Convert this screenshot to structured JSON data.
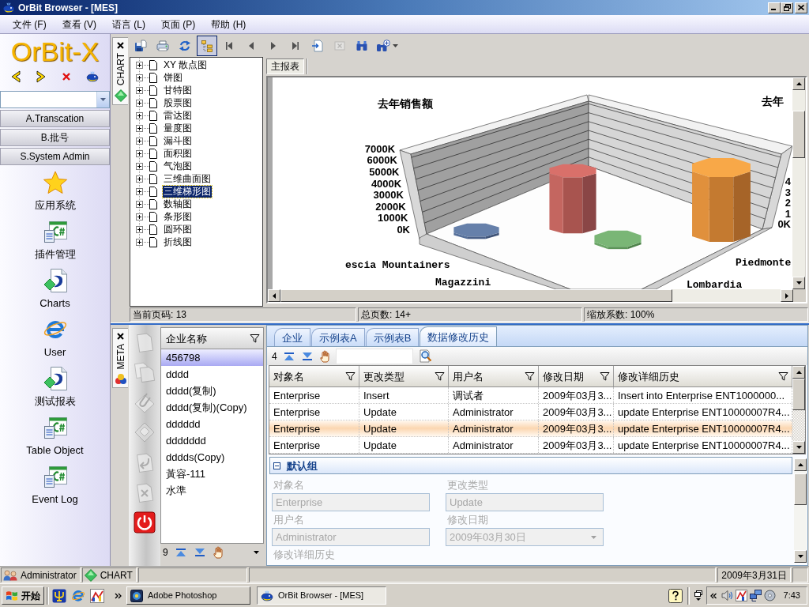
{
  "window": {
    "title": "OrBit Browser - [MES]"
  },
  "menu": [
    "文件 (F)",
    "查看 (V)",
    "语言 (L)",
    "页面 (P)",
    "帮助 (H)"
  ],
  "sidebar": {
    "logo": "OrBit-X",
    "sections": [
      {
        "label": "A.Transcation"
      },
      {
        "label": "B.批号"
      },
      {
        "label": "S.System Admin"
      }
    ],
    "items": [
      {
        "label": "应用系统",
        "kind": "star"
      },
      {
        "label": "插件管理",
        "kind": "csharp"
      },
      {
        "label": "Charts",
        "kind": "report"
      },
      {
        "label": "User",
        "kind": "browser"
      },
      {
        "label": "测试报表",
        "kind": "report"
      },
      {
        "label": "Table Object",
        "kind": "csharp"
      },
      {
        "label": "Event Log",
        "kind": "csharp"
      }
    ]
  },
  "chart_panel": {
    "side_tab": {
      "label": "CHART",
      "kind": "chart"
    },
    "toolbar": [
      {
        "kind": "save",
        "pressed": false,
        "disabled": false
      },
      {
        "kind": "print",
        "pressed": false,
        "disabled": false
      },
      {
        "kind": "refresh",
        "pressed": false,
        "disabled": false
      },
      {
        "kind": "tree",
        "pressed": true,
        "disabled": false
      },
      {
        "kind": "first",
        "pressed": false,
        "disabled": false
      },
      {
        "kind": "prev",
        "pressed": false,
        "disabled": false
      },
      {
        "kind": "next",
        "pressed": false,
        "disabled": false
      },
      {
        "kind": "last",
        "pressed": false,
        "disabled": false
      },
      {
        "kind": "export",
        "pressed": false,
        "disabled": false
      },
      {
        "kind": "close",
        "pressed": false,
        "disabled": true
      },
      {
        "kind": "find",
        "pressed": false,
        "disabled": false
      },
      {
        "kind": "find_more",
        "pressed": false,
        "disabled": false
      }
    ],
    "tree": [
      {
        "label": "XY 散点图",
        "expanded": false,
        "selected": false
      },
      {
        "label": "饼图",
        "expanded": false,
        "selected": false
      },
      {
        "label": "甘特图",
        "expanded": false,
        "selected": false
      },
      {
        "label": "股票图",
        "expanded": false,
        "selected": false
      },
      {
        "label": "雷达图",
        "expanded": false,
        "selected": false
      },
      {
        "label": "量度图",
        "expanded": false,
        "selected": false
      },
      {
        "label": "漏斗图",
        "expanded": false,
        "selected": false
      },
      {
        "label": "面积图",
        "expanded": false,
        "selected": false
      },
      {
        "label": "气泡图",
        "expanded": false,
        "selected": false
      },
      {
        "label": "三维曲面图",
        "expanded": false,
        "selected": false
      },
      {
        "label": "三维梯形图",
        "expanded": false,
        "selected": true
      },
      {
        "label": "数轴图",
        "expanded": false,
        "selected": false
      },
      {
        "label": "条形图",
        "expanded": false,
        "selected": false
      },
      {
        "label": "圆环图",
        "expanded": false,
        "selected": false
      },
      {
        "label": "折线图",
        "expanded": false,
        "selected": false
      }
    ],
    "report_tabs": [
      {
        "label": "主报表",
        "selected": true
      }
    ],
    "chart": {
      "title": "去年销售额",
      "title_right": "去年",
      "y_ticks": [
        "7000K",
        "6000K",
        "5000K",
        "4000K",
        "3000K",
        "2000K",
        "1000K",
        "0K"
      ],
      "right_ticks": [
        "4",
        "3",
        "2",
        "1",
        "0K"
      ],
      "labels": [
        "escia Mountainers",
        "Magazzini",
        "Piedmonte",
        "Lombardia"
      ]
    },
    "status": [
      "当前页码: 13",
      "总页数: 14+",
      "缩放系数: 100%"
    ]
  },
  "meta_panel": {
    "side_tab": {
      "label": "META",
      "kind": "meta"
    },
    "tools": [
      {
        "kind": "new",
        "disabled": true
      },
      {
        "kind": "copy",
        "disabled": true
      },
      {
        "kind": "attach",
        "disabled": true
      },
      {
        "kind": "save",
        "disabled": true
      },
      {
        "kind": "undo",
        "disabled": true
      },
      {
        "kind": "delete",
        "disabled": true
      },
      {
        "kind": "power",
        "disabled": false
      }
    ],
    "list": {
      "header": "企业名称",
      "items": [
        {
          "label": "456798",
          "selected": true
        },
        {
          "label": "dddd",
          "selected": false
        },
        {
          "label": "dddd(复制)",
          "selected": false
        },
        {
          "label": "dddd(复制)(Copy)",
          "selected": false
        },
        {
          "label": "dddddd",
          "selected": false
        },
        {
          "label": "ddddddd",
          "selected": false
        },
        {
          "label": "dddds(Copy)",
          "selected": false
        },
        {
          "label": "黃容-111",
          "selected": false
        },
        {
          "label": "水準",
          "selected": false
        }
      ],
      "count": "9"
    },
    "tabs": [
      {
        "label": "企业",
        "selected": false
      },
      {
        "label": "示例表A",
        "selected": false
      },
      {
        "label": "示例表B",
        "selected": false
      },
      {
        "label": "数据修改历史",
        "selected": true
      }
    ],
    "grid_count": "4",
    "grid": {
      "columns": [
        "对象名",
        "更改类型",
        "用户名",
        "修改日期",
        "修改详细历史"
      ],
      "rows": [
        {
          "cells": [
            "Enterprise",
            "Insert",
            "调试者",
            "2009年03月3...",
            "Insert into Enterprise ENT1000000..."
          ],
          "selected": false
        },
        {
          "cells": [
            "Enterprise",
            "Update",
            "Administrator",
            "2009年03月3...",
            "update Enterprise ENT10000007R4..."
          ],
          "selected": false
        },
        {
          "cells": [
            "Enterprise",
            "Update",
            "Administrator",
            "2009年03月3...",
            "update Enterprise ENT10000007R4..."
          ],
          "selected": true
        },
        {
          "cells": [
            "Enterprise",
            "Update",
            "Administrator",
            "2009年03月3...",
            "update Enterprise ENT10000007R4..."
          ],
          "selected": false
        }
      ]
    },
    "group": {
      "title": "默认组",
      "expanded": true
    },
    "form": [
      {
        "label": "对象名",
        "value": "Enterprise",
        "kind": "text",
        "disabled": true
      },
      {
        "label": "更改类型",
        "value": "Update",
        "kind": "text",
        "disabled": true
      },
      {
        "label": "用户名",
        "value": "Administrator",
        "kind": "text",
        "disabled": true
      },
      {
        "label": "修改日期",
        "value": "2009年03月30日",
        "kind": "dropdown",
        "disabled": true
      },
      {
        "label": "修改详细历史",
        "kind": "memo",
        "disabled": true
      }
    ]
  },
  "status_bar": {
    "panes": [
      {
        "label": "Administrator",
        "kind": "user"
      },
      {
        "label": "CHART",
        "kind": "chart"
      }
    ],
    "date": "2009年3月31日"
  },
  "taskbar": {
    "start": "开始",
    "tasks": [
      {
        "label": "Adobe Photoshop",
        "kind": "photo",
        "selected": false
      },
      {
        "label": "OrBit Browser - [MES]",
        "kind": "orbit",
        "selected": true
      }
    ],
    "clock": "7:43"
  }
}
